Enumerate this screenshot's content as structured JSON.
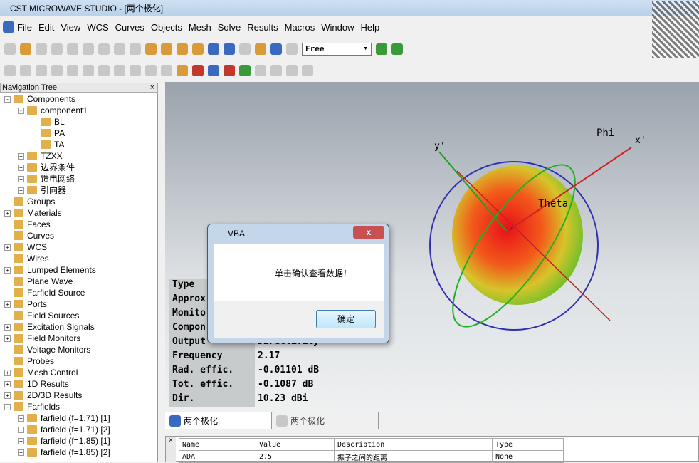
{
  "window": {
    "title": "CST MICROWAVE STUDIO - [两个极化]"
  },
  "menu": [
    "File",
    "Edit",
    "View",
    "WCS",
    "Curves",
    "Objects",
    "Mesh",
    "Solve",
    "Results",
    "Macros",
    "Window",
    "Help"
  ],
  "toolbar": {
    "mode_select": "Free"
  },
  "nav": {
    "title": "Navigation Tree",
    "close": "×",
    "items": [
      {
        "label": "Components",
        "level": 0,
        "exp": "-"
      },
      {
        "label": "component1",
        "level": 1,
        "exp": "-"
      },
      {
        "label": "BL",
        "level": 2,
        "exp": ""
      },
      {
        "label": "PA",
        "level": 2,
        "exp": ""
      },
      {
        "label": "TA",
        "level": 2,
        "exp": ""
      },
      {
        "label": "TZXX",
        "level": 1,
        "exp": "+"
      },
      {
        "label": "边界条件",
        "level": 1,
        "exp": "+"
      },
      {
        "label": "馈电网络",
        "level": 1,
        "exp": "+"
      },
      {
        "label": "引向器",
        "level": 1,
        "exp": "+"
      },
      {
        "label": "Groups",
        "level": 0,
        "exp": ""
      },
      {
        "label": "Materials",
        "level": 0,
        "exp": "+"
      },
      {
        "label": "Faces",
        "level": 0,
        "exp": ""
      },
      {
        "label": "Curves",
        "level": 0,
        "exp": ""
      },
      {
        "label": "WCS",
        "level": 0,
        "exp": "+"
      },
      {
        "label": "Wires",
        "level": 0,
        "exp": ""
      },
      {
        "label": "Lumped Elements",
        "level": 0,
        "exp": "+"
      },
      {
        "label": "Plane Wave",
        "level": 0,
        "exp": ""
      },
      {
        "label": "Farfield Source",
        "level": 0,
        "exp": ""
      },
      {
        "label": "Ports",
        "level": 0,
        "exp": "+"
      },
      {
        "label": "Field Sources",
        "level": 0,
        "exp": ""
      },
      {
        "label": "Excitation Signals",
        "level": 0,
        "exp": "+"
      },
      {
        "label": "Field Monitors",
        "level": 0,
        "exp": "+"
      },
      {
        "label": "Voltage Monitors",
        "level": 0,
        "exp": ""
      },
      {
        "label": "Probes",
        "level": 0,
        "exp": ""
      },
      {
        "label": "Mesh Control",
        "level": 0,
        "exp": "+"
      },
      {
        "label": "1D Results",
        "level": 0,
        "exp": "+"
      },
      {
        "label": "2D/3D Results",
        "level": 0,
        "exp": "+"
      },
      {
        "label": "Farfields",
        "level": 0,
        "exp": "-"
      },
      {
        "label": "farfield (f=1.71) [1]",
        "level": 1,
        "exp": "+"
      },
      {
        "label": "farfield (f=1.71) [2]",
        "level": 1,
        "exp": "+"
      },
      {
        "label": "farfield (f=1.85) [1]",
        "level": 1,
        "exp": "+"
      },
      {
        "label": "farfield (f=1.85) [2]",
        "level": 1,
        "exp": "+"
      }
    ]
  },
  "view": {
    "axes": {
      "x": "x'",
      "y": "y'",
      "z": "z",
      "phi": "Phi",
      "theta": "Theta"
    },
    "info": [
      {
        "k": "Type",
        "v": ""
      },
      {
        "k": "Approx",
        "v": ""
      },
      {
        "k": "Monito",
        "v": ""
      },
      {
        "k": "Compon",
        "v": ""
      },
      {
        "k": "Output",
        "v": "Directivity"
      },
      {
        "k": "Frequency",
        "v": "2.17"
      },
      {
        "k": "Rad. effic.",
        "v": "-0.01101 dB"
      },
      {
        "k": "Tot. effic.",
        "v": "-0.1087 dB"
      },
      {
        "k": "Dir.",
        "v": " 10.23 dBi"
      }
    ]
  },
  "dialog": {
    "title": "VBA",
    "close": "x",
    "message": "单击确认查看数据！",
    "ok": "确定"
  },
  "tabs": [
    "两个极化",
    "两个极化"
  ],
  "params": {
    "headers": [
      "Name",
      "Value",
      "Description",
      "Type"
    ],
    "rows": [
      [
        "ADA",
        "2.5",
        "振子之间的距离",
        "None"
      ]
    ]
  }
}
